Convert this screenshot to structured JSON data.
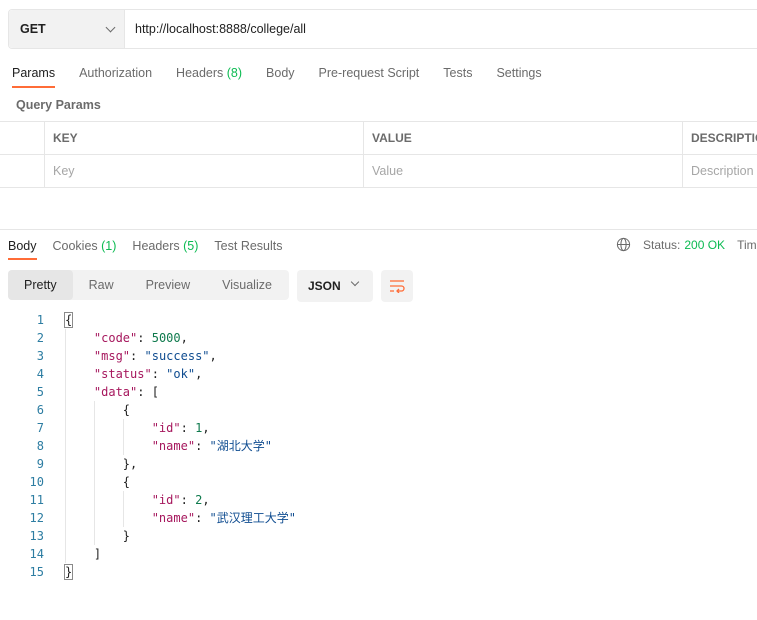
{
  "request": {
    "method": "GET",
    "url": "http://localhost:8888/college/all"
  },
  "request_tabs": [
    {
      "label": "Params",
      "active": true
    },
    {
      "label": "Authorization"
    },
    {
      "label": "Headers",
      "count": "(8)"
    },
    {
      "label": "Body"
    },
    {
      "label": "Pre-request Script"
    },
    {
      "label": "Tests"
    },
    {
      "label": "Settings"
    }
  ],
  "query_params": {
    "title": "Query Params",
    "columns": {
      "key": "KEY",
      "value": "VALUE",
      "description": "DESCRIPTION"
    },
    "placeholders": {
      "key": "Key",
      "value": "Value",
      "description": "Description"
    }
  },
  "response_tabs": [
    {
      "label": "Body",
      "active": true
    },
    {
      "label": "Cookies",
      "count": "(1)"
    },
    {
      "label": "Headers",
      "count": "(5)"
    },
    {
      "label": "Test Results"
    }
  ],
  "status": {
    "label": "Status:",
    "value": "200 OK",
    "time_label": "Time"
  },
  "view_tabs": [
    "Pretty",
    "Raw",
    "Preview",
    "Visualize"
  ],
  "format": "JSON",
  "icons": {
    "method_dropdown": "chevron-down-icon",
    "globe": "globe-icon",
    "format_dropdown": "chevron-down-icon",
    "wrap": "wrap-lines-icon"
  },
  "colors": {
    "accent": "#ff6c37",
    "status_ok": "#0cbb52",
    "json_key": "#a6175d",
    "json_string": "#0f4c90",
    "json_number": "#0f7a4d",
    "line_number": "#2d7da2"
  },
  "response_body_lines": [
    "{",
    "    \"code\": 5000,",
    "    \"msg\": \"success\",",
    "    \"status\": \"ok\",",
    "    \"data\": [",
    "        {",
    "            \"id\": 1,",
    "            \"name\": \"湖北大学\"",
    "        },",
    "        {",
    "            \"id\": 2,",
    "            \"name\": \"武汉理工大学\"",
    "        }",
    "    ]",
    "}"
  ]
}
